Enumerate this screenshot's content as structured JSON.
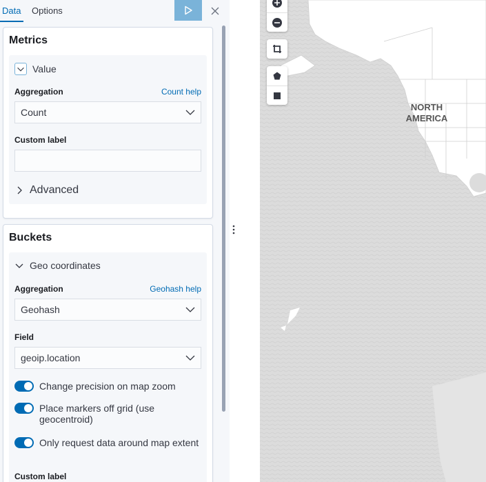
{
  "tabs": [
    {
      "label": "Data"
    },
    {
      "label": "Options"
    }
  ],
  "toolbar": {
    "apply_icon": "play-icon",
    "discard_icon": "close-icon"
  },
  "metrics": {
    "title": "Metrics",
    "agg_name": "Value",
    "aggregation_label": "Aggregation",
    "aggregation_help": "Count help",
    "aggregation_value": "Count",
    "custom_label_label": "Custom label",
    "custom_label_value": "",
    "advanced_label": "Advanced"
  },
  "buckets": {
    "title": "Buckets",
    "agg_name": "Geo coordinates",
    "aggregation_label": "Aggregation",
    "aggregation_help": "Geohash help",
    "aggregation_value": "Geohash",
    "field_label": "Field",
    "field_value": "geoip.location",
    "switches": [
      {
        "label": "Change precision on map zoom",
        "on": true
      },
      {
        "label": "Place markers off grid (use geocentroid)",
        "on": true
      },
      {
        "label": "Only request data around map extent",
        "on": true
      }
    ],
    "custom_label_label": "Custom label"
  },
  "map": {
    "continent_label_line1": "NORTH",
    "continent_label_line2": "AMERICA",
    "controls": [
      "zoom-in-icon",
      "zoom-out-icon",
      "fit-bounds-icon",
      "draw-polygon-icon",
      "draw-rectangle-icon"
    ]
  },
  "colors": {
    "accent": "#006bb4",
    "apply_button": "#7ab3d9",
    "sidebar_bg": "#f5f7fa",
    "map_bg": "#dddddd"
  }
}
